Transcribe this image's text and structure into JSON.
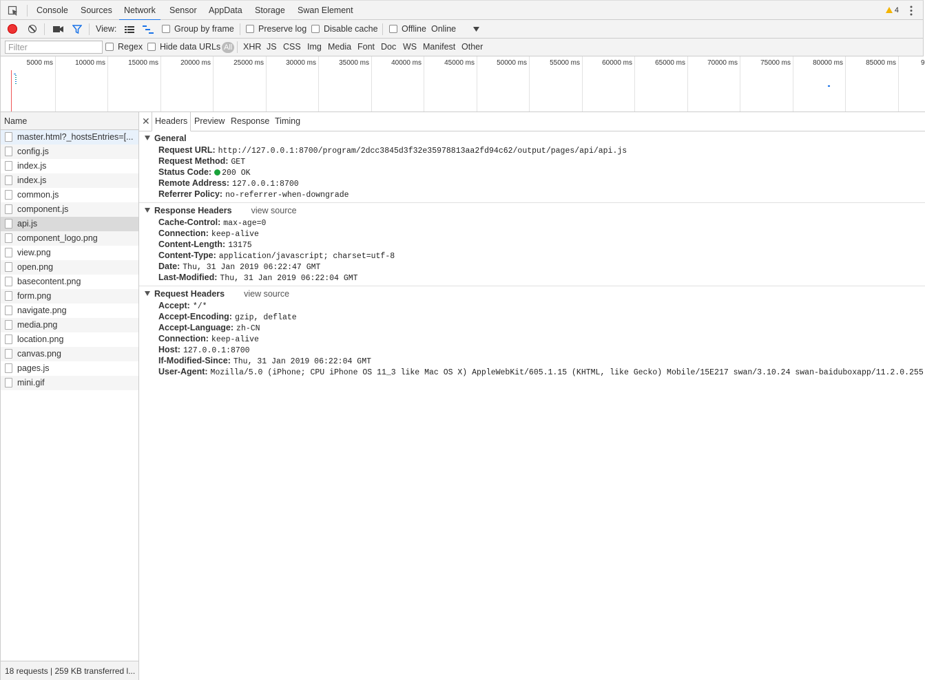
{
  "tabs": [
    "Console",
    "Sources",
    "Network",
    "Sensor",
    "AppData",
    "Storage",
    "Swan Element"
  ],
  "active_tab": "Network",
  "warning_count": "4",
  "toolbar": {
    "view_label": "View:",
    "group_by_frame": "Group by frame",
    "preserve_log": "Preserve log",
    "disable_cache": "Disable cache",
    "offline": "Offline",
    "online": "Online"
  },
  "filter_bar": {
    "placeholder": "Filter",
    "regex": "Regex",
    "hide_data_urls": "Hide data URLs",
    "all": "All",
    "types": [
      "XHR",
      "JS",
      "CSS",
      "Img",
      "Media",
      "Font",
      "Doc",
      "WS",
      "Manifest",
      "Other"
    ]
  },
  "timeline": {
    "ticks": [
      "5000 ms",
      "10000 ms",
      "15000 ms",
      "20000 ms",
      "25000 ms",
      "30000 ms",
      "35000 ms",
      "40000 ms",
      "45000 ms",
      "50000 ms",
      "55000 ms",
      "60000 ms",
      "65000 ms",
      "70000 ms",
      "75000 ms",
      "80000 ms",
      "85000 ms",
      "9"
    ]
  },
  "name_header": "Name",
  "files": [
    "master.html?_hostsEntries=[...",
    "config.js",
    "index.js",
    "index.js",
    "common.js",
    "component.js",
    "api.js",
    "component_logo.png",
    "view.png",
    "open.png",
    "basecontent.png",
    "form.png",
    "navigate.png",
    "media.png",
    "location.png",
    "canvas.png",
    "pages.js",
    "mini.gif"
  ],
  "selected_file": "api.js",
  "status": "18 requests | 259 KB transferred l...",
  "detail_tabs": [
    "Headers",
    "Preview",
    "Response",
    "Timing"
  ],
  "general": {
    "title": "General",
    "rows": [
      {
        "k": "Request URL:",
        "v": "http://127.0.0.1:8700/program/2dcc3845d3f32e35978813aa2fd94c62/output/pages/api/api.js"
      },
      {
        "k": "Request Method:",
        "v": "GET"
      },
      {
        "k": "Status Code:",
        "v": "200 OK"
      },
      {
        "k": "Remote Address:",
        "v": "127.0.0.1:8700"
      },
      {
        "k": "Referrer Policy:",
        "v": "no-referrer-when-downgrade"
      }
    ]
  },
  "response_headers": {
    "title": "Response Headers",
    "view_source": "view source",
    "rows": [
      {
        "k": "Cache-Control:",
        "v": "max-age=0"
      },
      {
        "k": "Connection:",
        "v": "keep-alive"
      },
      {
        "k": "Content-Length:",
        "v": "13175"
      },
      {
        "k": "Content-Type:",
        "v": "application/javascript; charset=utf-8"
      },
      {
        "k": "Date:",
        "v": "Thu, 31 Jan 2019 06:22:47 GMT"
      },
      {
        "k": "Last-Modified:",
        "v": "Thu, 31 Jan 2019 06:22:04 GMT"
      }
    ]
  },
  "request_headers": {
    "title": "Request Headers",
    "view_source": "view source",
    "rows": [
      {
        "k": "Accept:",
        "v": "*/*"
      },
      {
        "k": "Accept-Encoding:",
        "v": "gzip, deflate"
      },
      {
        "k": "Accept-Language:",
        "v": "zh-CN"
      },
      {
        "k": "Connection:",
        "v": "keep-alive"
      },
      {
        "k": "Host:",
        "v": "127.0.0.1:8700"
      },
      {
        "k": "If-Modified-Since:",
        "v": "Thu, 31 Jan 2019 06:22:04 GMT"
      },
      {
        "k": "User-Agent:",
        "v": "Mozilla/5.0 (iPhone; CPU iPhone OS 11_3 like Mac OS X) AppleWebKit/605.1.15 (KHTML, like Gecko) Mobile/15E217 swan/3.10.24 swan-baiduboxapp/11.2.0.255"
      }
    ]
  }
}
